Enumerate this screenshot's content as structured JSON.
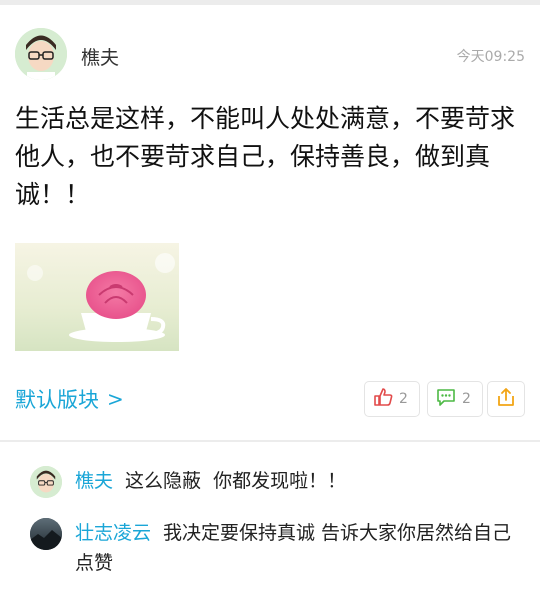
{
  "post": {
    "author": "樵夫",
    "time": "今天09:25",
    "text": "生活总是这样，不能叫人处处满意，不要苛求他人，也不要苛求自己，保持善良，做到真诚！！",
    "category": "默认版块",
    "category_chevron": ">",
    "likes": "2",
    "comments": "2",
    "share_icon": "share-icon",
    "like_icon": "thumbs-up-icon",
    "comment_icon": "comment-bubble-icon"
  },
  "comments": [
    {
      "name": "樵夫",
      "text": "这么隐蔽  你都发现啦！！"
    },
    {
      "name": "壮志凌云",
      "text": "我决定要保持真诚 告诉大家你居然给自己点赞"
    }
  ],
  "colors": {
    "accent": "#1aa6d7",
    "like": "#e24b4b",
    "comment": "#4cb944",
    "share": "#f2a516"
  }
}
